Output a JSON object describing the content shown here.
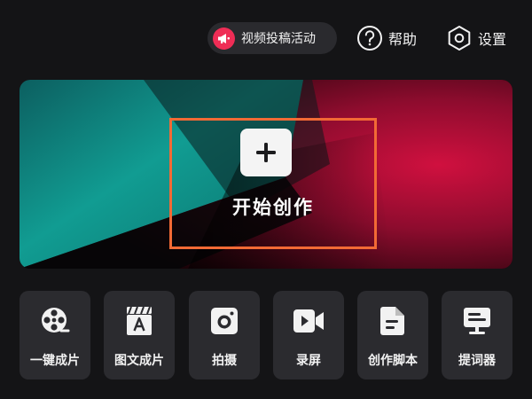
{
  "top_bar": {
    "promo_label": "视频投稿活动",
    "help_label": "帮助",
    "settings_label": "设置"
  },
  "hero": {
    "create_label": "开始创作"
  },
  "tools": [
    {
      "label": "一键成片",
      "icon": "film-reel-icon"
    },
    {
      "label": "图文成片",
      "icon": "clapperboard-text-icon"
    },
    {
      "label": "拍摄",
      "icon": "camera-icon"
    },
    {
      "label": "录屏",
      "icon": "video-record-icon"
    },
    {
      "label": "创作脚本",
      "icon": "script-document-icon"
    },
    {
      "label": "提词器",
      "icon": "teleprompter-icon"
    }
  ],
  "colors": {
    "background": "#141416",
    "tile": "#2b2b2f",
    "accent_red": "#ef2d56",
    "highlight_orange": "#f26a35",
    "hero_teal": "#0e9a90",
    "hero_crimson": "#c8103f"
  }
}
